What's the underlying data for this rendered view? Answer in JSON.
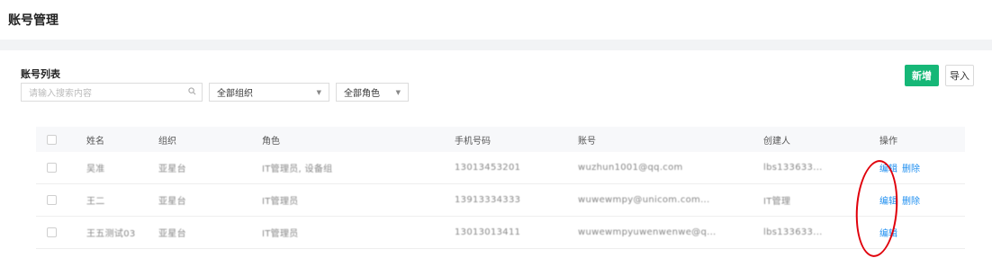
{
  "page": {
    "title": "账号管理"
  },
  "panel": {
    "title": "账号列表"
  },
  "toolbar": {
    "add_label": "新增",
    "import_label": "导入"
  },
  "filters": {
    "search_placeholder": "请输入搜索内容",
    "org_select": "全部组织",
    "role_select": "全部角色"
  },
  "table": {
    "headers": [
      "姓名",
      "组织",
      "角色",
      "手机号码",
      "账号",
      "创建人",
      "操作"
    ],
    "rows": [
      {
        "name": "吴准",
        "org": "亚星台",
        "role": "IT管理员, 设备组",
        "phone": "13013453201",
        "account": "wuzhun1001@qq.com",
        "creator": "lbs133633...",
        "actions": [
          "编辑",
          "删除"
        ]
      },
      {
        "name": "王二",
        "org": "亚星台",
        "role": "IT管理员",
        "phone": "13913334333",
        "account": "wuwewmpy@unicom.com...",
        "creator": "IT管理",
        "actions": [
          "编辑",
          "删除"
        ]
      },
      {
        "name": "王五测试03",
        "org": "亚星台",
        "role": "IT管理员",
        "phone": "13013013411",
        "account": "wuwewmpyuwenwenwe@q...",
        "creator": "lbs133633...",
        "actions": [
          "编辑"
        ]
      }
    ]
  },
  "colors": {
    "primary": "#16b777",
    "link": "#1f8ff0",
    "highlight": "#e0000b"
  }
}
